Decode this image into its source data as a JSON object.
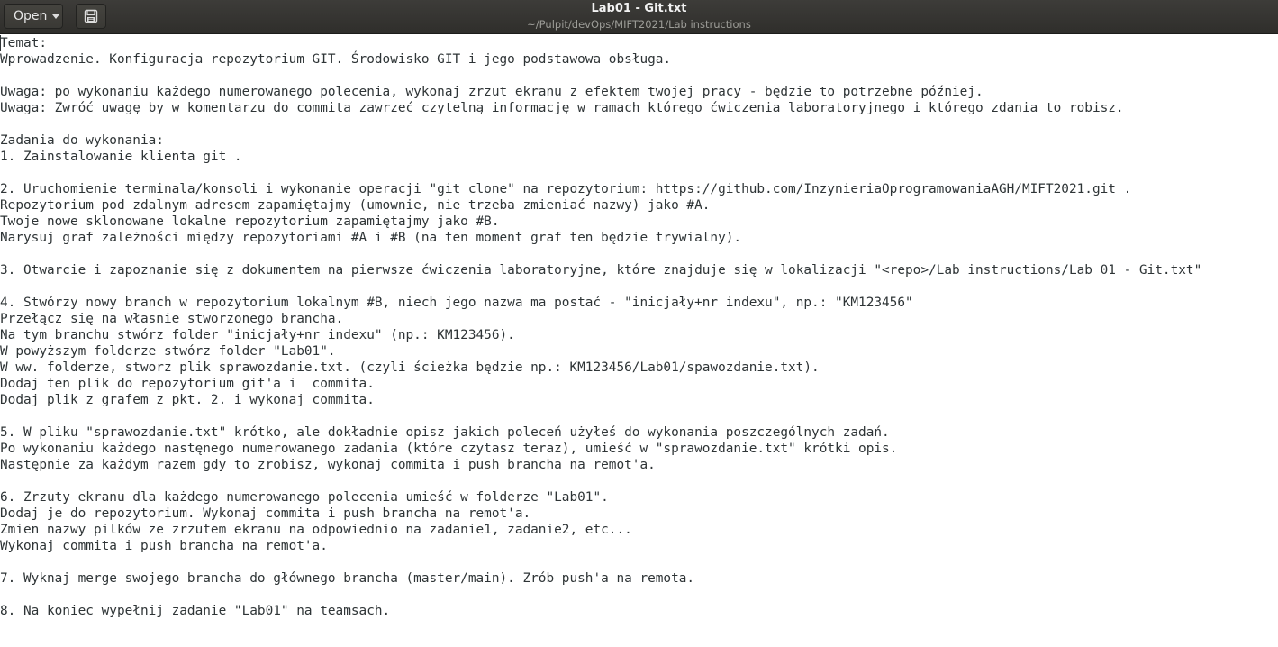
{
  "window": {
    "title": "Lab01 - Git.txt",
    "subtitle": "~/Pulpit/devOps/MIFT2021/Lab instructions"
  },
  "toolbar": {
    "open_label": "Open",
    "open_icon": "chevron-down-icon",
    "save_copy_icon": "save-copy-icon"
  },
  "colors": {
    "headerbar": "#3d3c39",
    "text": "#2e3436",
    "background": "#ffffff"
  },
  "document": {
    "lines": [
      "Temat:",
      "Wprowadzenie. Konfiguracja repozytorium GIT. Środowisko GIT i jego podstawowa obsługa.",
      "",
      "Uwaga: po wykonaniu każdego numerowanego polecenia, wykonaj zrzut ekranu z efektem twojej pracy - będzie to potrzebne później.",
      "Uwaga: Zwróć uwagę by w komentarzu do commita zawrzeć czytelną informację w ramach którego ćwiczenia laboratoryjnego i którego zdania to robisz.",
      "",
      "Zadania do wykonania:",
      "1. Zainstalowanie klienta git .",
      "",
      "2. Uruchomienie terminala/konsoli i wykonanie operacji \"git clone\" na repozytorium: https://github.com/InzynieriaOprogramowaniaAGH/MIFT2021.git .",
      "Repozytorium pod zdalnym adresem zapamiętajmy (umownie, nie trzeba zmieniać nazwy) jako #A.",
      "Twoje nowe sklonowane lokalne repozytorium zapamiętajmy jako #B.",
      "Narysuj graf zależności między repozytoriami #A i #B (na ten moment graf ten będzie trywialny).",
      "",
      "3. Otwarcie i zapoznanie się z dokumentem na pierwsze ćwiczenia laboratoryjne, które znajduje się w lokalizacji \"<repo>/Lab instructions/Lab 01 - Git.txt\"",
      "",
      "4. Stwórzy nowy branch w repozytorium lokalnym #B, niech jego nazwa ma postać - \"inicjały+nr indexu\", np.: \"KM123456\"",
      "Przełącz się na własnie stworzonego brancha.",
      "Na tym branchu stwórz folder \"inicjały+nr indexu\" (np.: KM123456).",
      "W powyższym folderze stwórz folder \"Lab01\".",
      "W ww. folderze, stworz plik sprawozdanie.txt. (czyli ścieżka będzie np.: KM123456/Lab01/spawozdanie.txt).",
      "Dodaj ten plik do repozytorium git'a i  commita.",
      "Dodaj plik z grafem z pkt. 2. i wykonaj commita.",
      "",
      "5. W pliku \"sprawozdanie.txt\" krótko, ale dokładnie opisz jakich poleceń użyłeś do wykonania poszczególnych zadań.",
      "Po wykonaniu każdego nastęnego numerowanego zadania (które czytasz teraz), umieść w \"sprawozdanie.txt\" krótki opis.",
      "Następnie za każdym razem gdy to zrobisz, wykonaj commita i push brancha na remot'a.",
      "",
      "6. Zrzuty ekranu dla każdego numerowanego polecenia umieść w folderze \"Lab01\".",
      "Dodaj je do repozytorium. Wykonaj commita i push brancha na remot'a.",
      "Zmien nazwy pilków ze zrzutem ekranu na odpowiednio na zadanie1, zadanie2, etc...",
      "Wykonaj commita i push brancha na remot'a.",
      "",
      "7. Wyknaj merge swojego brancha do głównego brancha (master/main). Zrób push'a na remota.",
      "",
      "8. Na koniec wypełnij zadanie \"Lab01\" na teamsach."
    ]
  }
}
